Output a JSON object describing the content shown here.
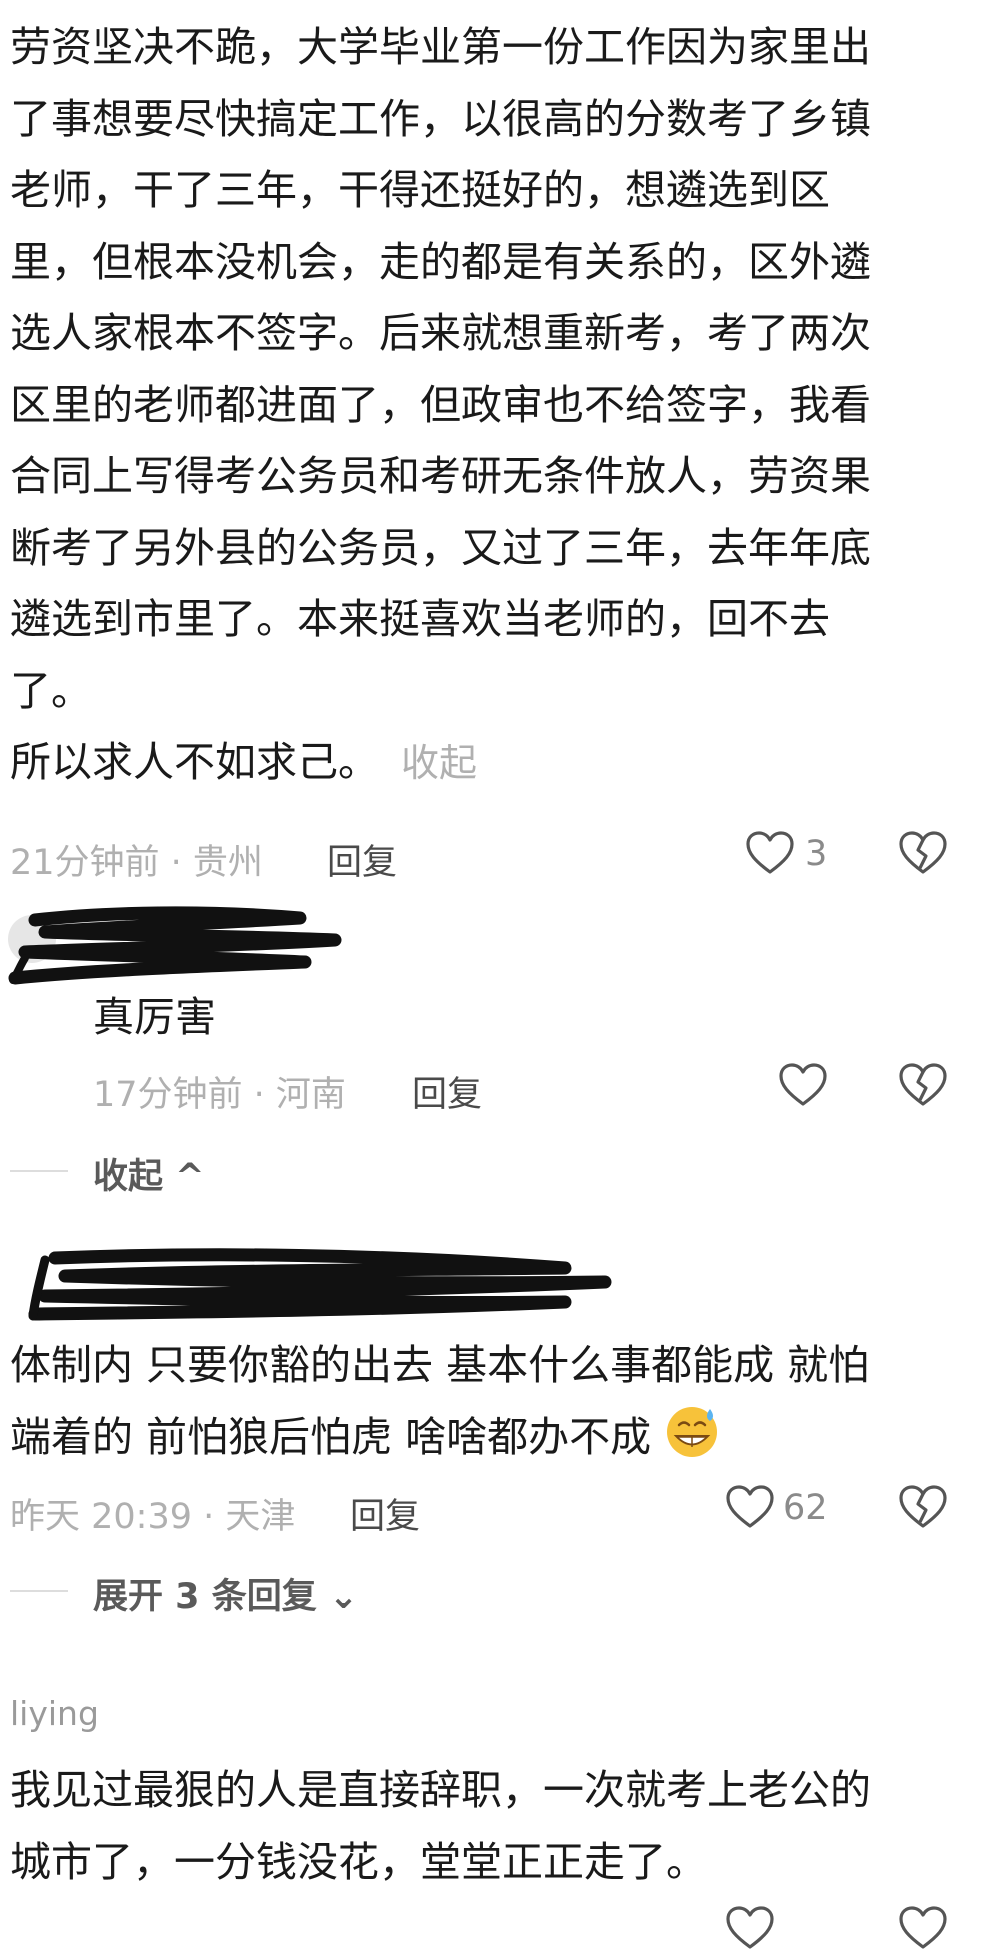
{
  "comment1": {
    "lines": [
      "劳资坚决不跪，大学毕业第一份工作因为家里出",
      "了事想要尽快搞定工作，以很高的分数考了乡镇",
      "老师，干了三年，干得还挺好的，想遴选到区",
      "里，但根本没机会，走的都是有关系的，区外遴",
      "选人家根本不签字。后来就想重新考，考了两次",
      "区里的老师都进面了，但政审也不给签字，我看",
      "合同上写得考公务员和考研无条件放人，劳资果",
      "断考了另外县的公务员，又过了三年，去年年底",
      "遴选到市里了。本来挺喜欢当老师的，回不去",
      "了。",
      "所以求人不如求己。"
    ],
    "collapse_label": "收起",
    "meta": "21分钟前 · 贵州",
    "reply_label": "回复",
    "like_count": "3"
  },
  "reply1": {
    "text": "真厉害",
    "meta": "17分钟前 · 河南",
    "reply_label": "回复"
  },
  "collapse_thread": {
    "label": "收起 ^"
  },
  "comment2": {
    "lines": [
      "体制内 只要你豁的出去 基本什么事都能成 就怕",
      "端着的 前怕狼后怕虎 啥啥都办不成"
    ],
    "emoji": "grinning-sweat-emoji",
    "meta": "昨天 20:39 · 天津",
    "reply_label": "回复",
    "like_count": "62"
  },
  "expand_thread": {
    "label": "展开 3 条回复 ⌄"
  },
  "comment3": {
    "username": "liying",
    "lines": [
      "我见过最狠的人是直接辞职，一次就考上老公的",
      "城市了，一分钱没花，堂堂正正走了。"
    ]
  },
  "colors": {
    "text": "#1a1a1a",
    "meta": "#b0b0b0",
    "icon": "#555555",
    "redaction": "#111111"
  }
}
